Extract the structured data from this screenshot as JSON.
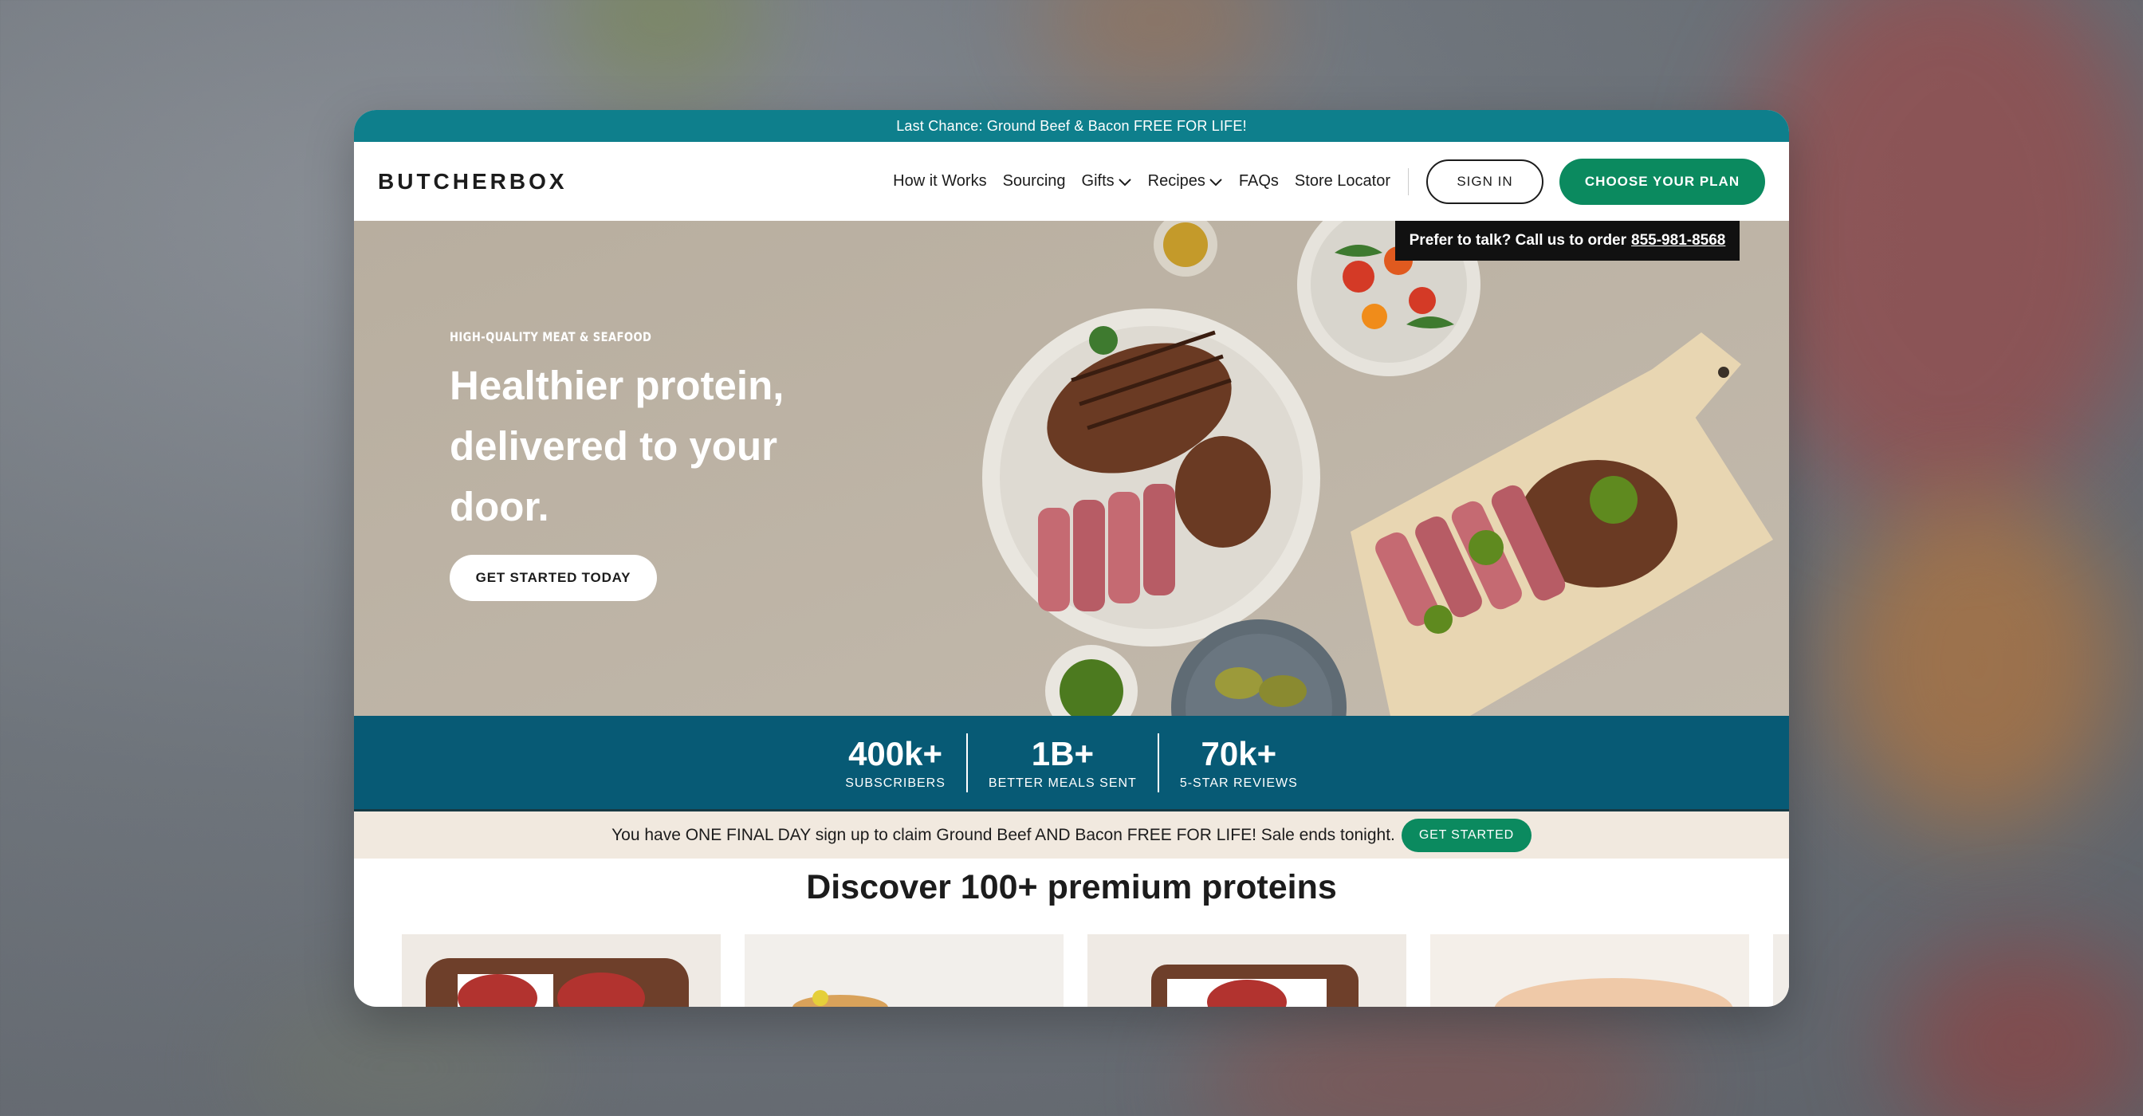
{
  "promo_bar": {
    "text": "Last Chance: Ground Beef & Bacon FREE FOR LIFE!"
  },
  "header": {
    "logo": "BUTCHERBOX",
    "nav": [
      {
        "label": "How it Works",
        "has_dropdown": false
      },
      {
        "label": "Sourcing",
        "has_dropdown": false
      },
      {
        "label": "Gifts",
        "has_dropdown": true
      },
      {
        "label": "Recipes",
        "has_dropdown": true
      },
      {
        "label": "FAQs",
        "has_dropdown": false
      },
      {
        "label": "Store Locator",
        "has_dropdown": false
      }
    ],
    "sign_in_label": "SIGN IN",
    "cta_label": "CHOOSE YOUR PLAN"
  },
  "hero": {
    "call_text": "Prefer to talk? Call us to order",
    "phone": "855-981-8568",
    "eyebrow": "HIGH-QUALITY MEAT & SEAFOOD",
    "headline_line1": "Healthier protein,",
    "headline_line2": "delivered to your",
    "headline_line3": "door.",
    "cta_label": "GET STARTED TODAY"
  },
  "stats": [
    {
      "value": "400k+",
      "label": "SUBSCRIBERS"
    },
    {
      "value": "1B+",
      "label": "BETTER MEALS SENT"
    },
    {
      "value": "70k+",
      "label": "5-STAR REVIEWS"
    }
  ],
  "sale_bar": {
    "text": "You have ONE FINAL DAY sign up to claim Ground Beef AND Bacon FREE FOR LIFE! Sale ends tonight.",
    "cta_label": "GET STARTED"
  },
  "discover": {
    "title": "Discover 100+ premium proteins"
  },
  "colors": {
    "promo_teal": "#0e7f8c",
    "brand_green": "#0b8a5f",
    "stats_blue": "#075a75",
    "sale_cream": "#f1e9df"
  }
}
